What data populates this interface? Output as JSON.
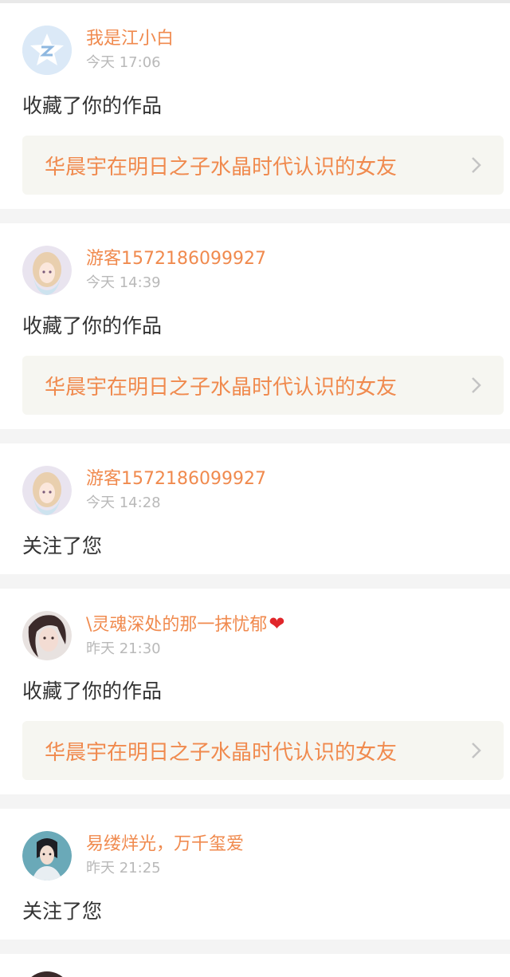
{
  "feed": {
    "items": [
      {
        "avatar": "qq-star-avatar",
        "name": "我是江小白",
        "time": "今天 17:06",
        "action": "收藏了你的作品",
        "work_title": "华晨宇在明日之子水晶时代认识的女友"
      },
      {
        "avatar": "anime-girl-avatar",
        "name": "游客1572186099927",
        "time": "今天 14:39",
        "action": "收藏了你的作品",
        "work_title": "华晨宇在明日之子水晶时代认识的女友"
      },
      {
        "avatar": "anime-girl-avatar",
        "name": "游客1572186099927",
        "time": "今天 14:28",
        "action": "关注了您"
      },
      {
        "avatar": "girl-photo-avatar",
        "name": "\\灵魂深处的那一抹忧郁",
        "time": "昨天 21:30",
        "action": "收藏了你的作品",
        "work_title": "华晨宇在明日之子水晶时代认识的女友"
      },
      {
        "avatar": "ancient-costume-avatar",
        "name": "易缕烊光，万千玺爱",
        "time": "昨天 21:25",
        "action": "关注了您"
      }
    ],
    "heart_icon": "heart-icon",
    "chevron_icon": "chevron-right-icon"
  },
  "colors": {
    "accent": "#f08a4e",
    "time": "#b9b9b9",
    "text": "#333333",
    "work_bg": "#f6f6f1",
    "separator": "#f4f4f4",
    "heart": "#e0262a"
  }
}
